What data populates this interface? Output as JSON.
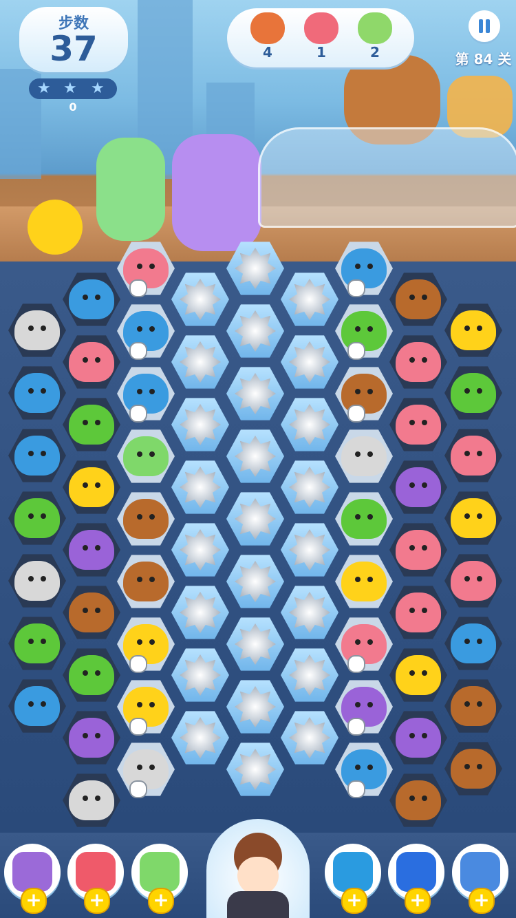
{
  "hud": {
    "moves_label": "步数",
    "moves_value": "37",
    "score_value": "0",
    "level_text": "第 84 关"
  },
  "goals": [
    {
      "icon": "hotdog-icon",
      "count": "4",
      "color": "#e8743a"
    },
    {
      "icon": "strawberry-cake-icon",
      "count": "1",
      "color": "#f06a7a"
    },
    {
      "icon": "ice-cream-icon",
      "count": "2",
      "color": "#8fd86a"
    }
  ],
  "colors": {
    "bear": "#b86a2c",
    "panda": "#d8d8d8",
    "pink": "#f27a8e",
    "blue": "#3a9be0",
    "green": "#5dc83a",
    "purple": "#9a63d8",
    "chick": "#ffd21a",
    "candy": "#7fd86a"
  },
  "boosters": [
    {
      "icon": "hammer-icon",
      "color": "#9b6ad8"
    },
    {
      "icon": "rocket-icon",
      "color": "#ef5a6a"
    },
    {
      "icon": "fan-icon",
      "color": "#7fd86a"
    },
    {
      "icon": "swap-arrows-icon",
      "color": "#2a9be0"
    },
    {
      "icon": "color-grid-icon",
      "color": "#2a6ee0"
    },
    {
      "icon": "hourglass-icon",
      "color": "#4a8ae0"
    }
  ],
  "booster_plus": "+"
}
